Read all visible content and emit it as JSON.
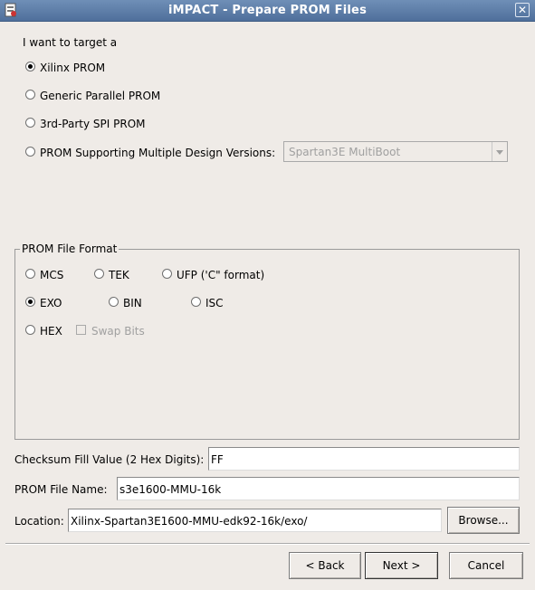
{
  "window": {
    "title": "iMPACT - Prepare PROM Files",
    "close_glyph": "✕",
    "icon": "impact-app-icon"
  },
  "target": {
    "intro": "I want to target a",
    "options": [
      {
        "label": "Xilinx PROM",
        "checked": true
      },
      {
        "label": "Generic Parallel PROM",
        "checked": false
      },
      {
        "label": "3rd-Party SPI PROM",
        "checked": false
      },
      {
        "label": "PROM Supporting Multiple Design Versions:",
        "checked": false
      }
    ],
    "multiboot_select": {
      "value": "Spartan3E MultiBoot",
      "enabled": false
    }
  },
  "format": {
    "legend": "PROM File Format",
    "options": [
      {
        "label": "MCS",
        "checked": false
      },
      {
        "label": "TEK",
        "checked": false
      },
      {
        "label": "UFP ('C\" format)",
        "checked": false
      },
      {
        "label": "EXO",
        "checked": true
      },
      {
        "label": "BIN",
        "checked": false
      },
      {
        "label": "ISC",
        "checked": false
      },
      {
        "label": "HEX",
        "checked": false
      }
    ],
    "swap_bits": {
      "label": "Swap Bits",
      "checked": false,
      "enabled": false
    }
  },
  "fields": {
    "checksum": {
      "label": "Checksum Fill Value (2 Hex Digits):",
      "value": "FF"
    },
    "prom_name": {
      "label": "PROM File Name:",
      "value": "s3e1600-MMU-16k"
    },
    "location": {
      "label": "Location:",
      "value": "Xilinx-Spartan3E1600-MMU-edk92-16k/exo/",
      "browse": "Browse..."
    }
  },
  "buttons": {
    "back": "< Back",
    "next": "Next >",
    "cancel": "Cancel"
  },
  "colors": {
    "titlebar": "#5a7aa6",
    "background": "#efebe7",
    "disabled_text": "#a0a0a0"
  }
}
